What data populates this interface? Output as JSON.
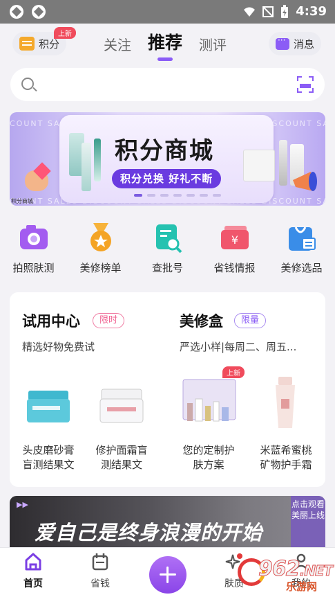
{
  "status_bar": {
    "time": "4:39"
  },
  "top_nav": {
    "points_label": "积分",
    "points_badge": "上新",
    "tabs": [
      {
        "label": "关注",
        "active": false
      },
      {
        "label": "推荐",
        "active": true
      },
      {
        "label": "测评",
        "active": false
      }
    ],
    "message_label": "消息"
  },
  "search": {
    "placeholder": ""
  },
  "banner": {
    "title": "积分商城",
    "subtitle": "积分兑换 好礼不断",
    "stripe_text": "COUNT SALES   DISCOUNT SALES   DISCOUNT SALES   DISCOUNT SALES",
    "corner_label": "积分商城",
    "dot_count": 7,
    "active_dot": 0
  },
  "quick_actions": [
    {
      "label": "拍照肤测",
      "icon": "camera-icon"
    },
    {
      "label": "美修榜单",
      "icon": "medal-icon"
    },
    {
      "label": "查批号",
      "icon": "search-document-icon"
    },
    {
      "label": "省钱情报",
      "icon": "coupon-icon"
    },
    {
      "label": "美修选品",
      "icon": "shopping-bag-icon"
    }
  ],
  "trial_center": {
    "title": "试用中心",
    "tag": "限时",
    "subtitle": "精选好物免费试",
    "products": [
      {
        "name_line1": "头皮磨砂膏",
        "name_line2": "盲测结果文"
      },
      {
        "name_line1": "修护面霜盲",
        "name_line2": "测结果文"
      }
    ]
  },
  "beauty_box": {
    "title": "美修盒",
    "tag": "限量",
    "subtitle": "严选小样|每周二、周五...",
    "badge": "上新",
    "products": [
      {
        "name_line1": "您的定制护",
        "name_line2": "肤方案"
      },
      {
        "name_line1": "米蓝希蜜桃",
        "name_line2": "矿物护手霜"
      }
    ]
  },
  "video_card": {
    "caption": "爱自己是终身浪漫的开始",
    "side_text": "点击观看美丽上线"
  },
  "bottom_nav": [
    {
      "label": "首页",
      "active": true
    },
    {
      "label": "省钱",
      "active": false
    },
    {
      "label": "肤质",
      "active": false
    },
    {
      "label": "我的",
      "active": false
    }
  ],
  "watermark": {
    "big": "962",
    "suffix": ".NET",
    "small": "乐游网"
  },
  "colors": {
    "accent": "#8b5cf6",
    "badge_red": "#f04b5c",
    "coin": "#f4a92c"
  }
}
